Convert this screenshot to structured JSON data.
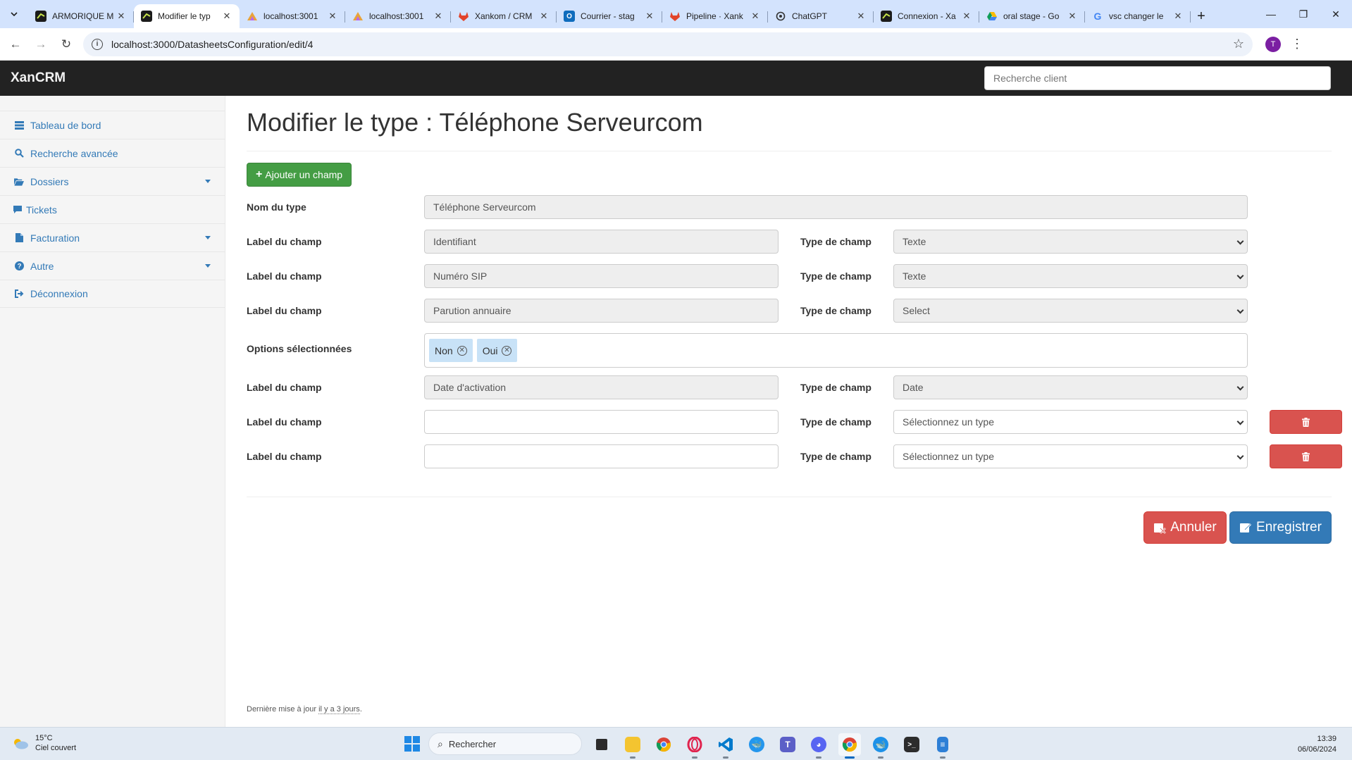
{
  "browser": {
    "tabs": [
      {
        "title": "ARMORIQUE M",
        "favicon": "xan-logo-icon",
        "active": false
      },
      {
        "title": "Modifier le typ",
        "favicon": "xan-logo-icon",
        "active": true
      },
      {
        "title": "localhost:3001",
        "favicon": "vite-icon",
        "active": false
      },
      {
        "title": "localhost:3001",
        "favicon": "vite-icon",
        "active": false
      },
      {
        "title": "Xankom / CRM",
        "favicon": "gitlab-icon",
        "active": false
      },
      {
        "title": "Courrier - stag",
        "favicon": "outlook-icon",
        "active": false
      },
      {
        "title": "Pipeline · Xank",
        "favicon": "gitlab-icon",
        "active": false
      },
      {
        "title": "ChatGPT",
        "favicon": "chatgpt-icon",
        "active": false
      },
      {
        "title": "Connexion - Xa",
        "favicon": "xan-logo-icon",
        "active": false
      },
      {
        "title": "oral stage - Go",
        "favicon": "google-drive-icon",
        "active": false
      },
      {
        "title": "vsc changer le",
        "favicon": "google-icon",
        "active": false
      }
    ],
    "url": "localhost:3000/DatasheetsConfiguration/edit/4",
    "profile_initial": "T"
  },
  "app": {
    "brand": "XanCRM",
    "client_search_placeholder": "Recherche client"
  },
  "sidebar": {
    "items": [
      {
        "label": "Tableau de bord",
        "icon": "dashboard-icon",
        "dropdown": false
      },
      {
        "label": "Recherche avancée",
        "icon": "search-icon",
        "dropdown": false
      },
      {
        "label": "Dossiers",
        "icon": "folder-open-icon",
        "dropdown": true
      },
      {
        "label": "Tickets",
        "icon": "comment-icon",
        "dropdown": false
      },
      {
        "label": "Facturation",
        "icon": "file-icon",
        "dropdown": true
      },
      {
        "label": "Autre",
        "icon": "question-circle-icon",
        "dropdown": true
      },
      {
        "label": "Déconnexion",
        "icon": "sign-out-icon",
        "dropdown": false
      }
    ]
  },
  "form": {
    "title": "Modifier le type : Téléphone Serveurcom",
    "add_field_label": "Ajouter un champ",
    "type_name_label": "Nom du type",
    "type_name_value": "Téléphone Serveurcom",
    "field_label": "Label du champ",
    "field_type_label": "Type de champ",
    "options_label": "Options sélectionnées",
    "fields": [
      {
        "label_value": "Identifiant",
        "type_value": "Texte"
      },
      {
        "label_value": "Numéro SIP",
        "type_value": "Texte"
      },
      {
        "label_value": "Parution annuaire",
        "type_value": "Select"
      },
      {
        "label_value": "Date d'activation",
        "type_value": "Date"
      },
      {
        "label_value": "",
        "type_value": "Sélectionnez un type"
      },
      {
        "label_value": "",
        "type_value": "Sélectionnez un type"
      }
    ],
    "selected_options": [
      "Non",
      "Oui"
    ],
    "cancel_label": "Annuler",
    "save_label": "Enregistrer",
    "footer_prefix": "Dernière mise à jour",
    "footer_ago": "il y a 3 jours",
    "footer_suffix": "."
  },
  "taskbar": {
    "weather_temp": "15°C",
    "weather_desc": "Ciel couvert",
    "search_placeholder": "Rechercher",
    "time": "13:39",
    "date": "06/06/2024"
  }
}
